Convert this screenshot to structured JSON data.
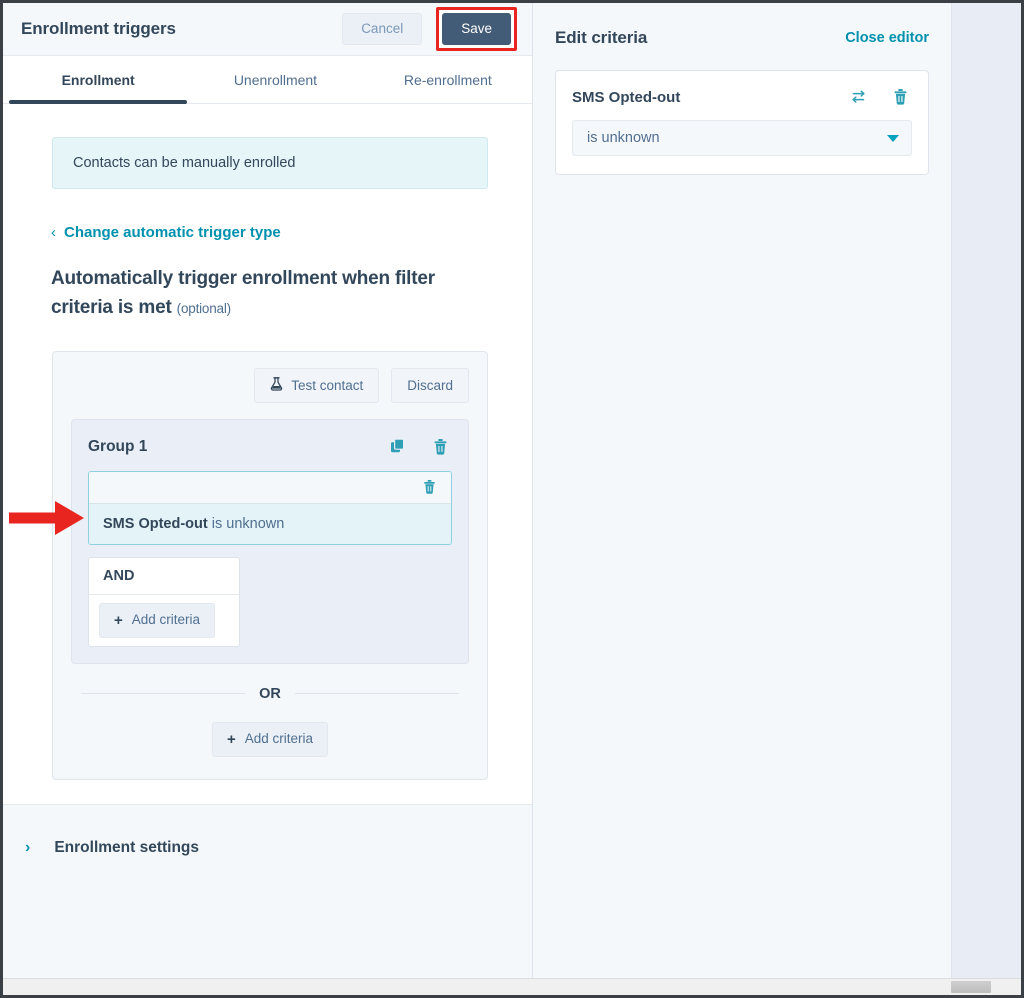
{
  "header": {
    "title": "Enrollment triggers",
    "cancel_label": "Cancel",
    "save_label": "Save"
  },
  "tabs": [
    {
      "label": "Enrollment",
      "active": true
    },
    {
      "label": "Unenrollment",
      "active": false
    },
    {
      "label": "Re-enrollment",
      "active": false
    }
  ],
  "left": {
    "info_banner": "Contacts can be manually enrolled",
    "change_trigger_link": "Change automatic trigger type",
    "change_trigger_chevron": "‹",
    "section_heading": "Automatically trigger enrollment when filter criteria is met",
    "section_optional": "(optional)",
    "test_contact_label": "Test contact",
    "discard_label": "Discard",
    "group": {
      "title": "Group 1",
      "criteria_property": "SMS Opted-out",
      "criteria_operator": "is unknown",
      "and_label": "AND",
      "add_criteria_inner_label": "Add criteria"
    },
    "or_label": "OR",
    "add_criteria_outer_label": "Add criteria",
    "enrollment_settings_label": "Enrollment settings",
    "enrollment_settings_chevron": "›"
  },
  "right": {
    "title": "Edit criteria",
    "close_editor_label": "Close editor",
    "card": {
      "property": "SMS Opted-out",
      "operator_value": "is unknown"
    }
  },
  "icons": {
    "test_contact": "flask-icon",
    "duplicate": "copy-icon",
    "delete": "trash-icon",
    "swap": "exchange-icon",
    "caret": "caret-down-icon",
    "plus": "plus-icon"
  },
  "colors": {
    "accent_teal": "#0091ae",
    "icon_teal": "#2f9fb5",
    "save_navy": "#425b76",
    "text_dark": "#33475b",
    "text_muted": "#516f90",
    "annotation_red": "#e8261f",
    "banner_bg": "#e5f5f8"
  }
}
